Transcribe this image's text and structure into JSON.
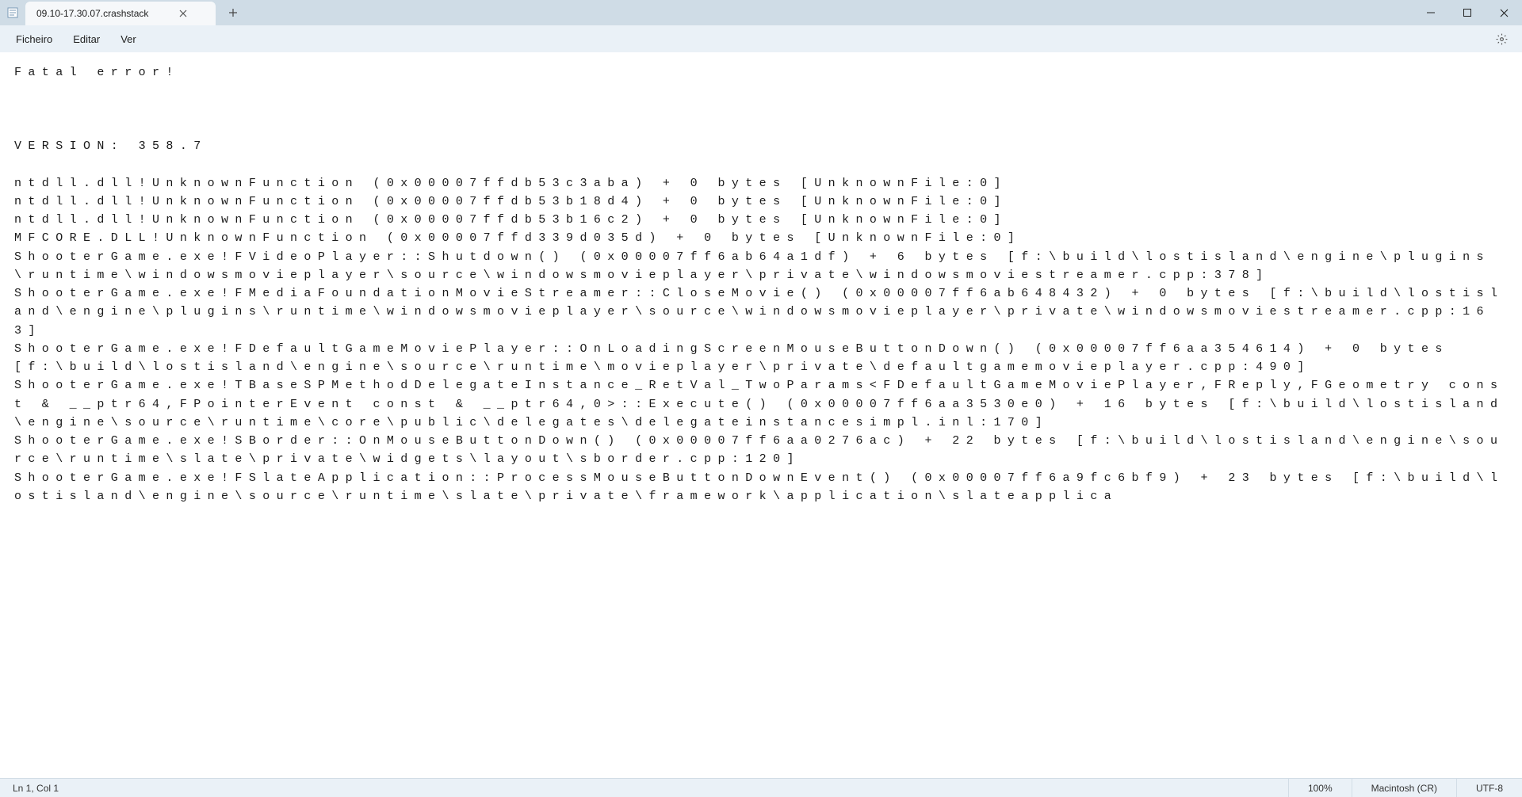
{
  "titlebar": {
    "tab_title": "09.10-17.30.07.crashstack"
  },
  "menubar": {
    "file": "Ficheiro",
    "edit": "Editar",
    "view": "Ver"
  },
  "editor": {
    "lines": [
      "Fatal error!",
      "",
      "",
      "",
      "VERSION: 358.7",
      "",
      "ntdll.dll!UnknownFunction (0x00007ffdb53c3aba) + 0 bytes [UnknownFile:0]",
      "ntdll.dll!UnknownFunction (0x00007ffdb53b18d4) + 0 bytes [UnknownFile:0]",
      "ntdll.dll!UnknownFunction (0x00007ffdb53b16c2) + 0 bytes [UnknownFile:0]",
      "MFCORE.DLL!UnknownFunction (0x00007ffd339d035d) + 0 bytes [UnknownFile:0]",
      "ShooterGame.exe!FVideoPlayer::Shutdown() (0x00007ff6ab64a1df) + 6 bytes [f:\\build\\lostisland\\engine\\plugins\\runtime\\windowsmovieplayer\\source\\windowsmovieplayer\\private\\windowsmoviestreamer.cpp:378]",
      "ShooterGame.exe!FMediaFoundationMovieStreamer::CloseMovie() (0x00007ff6ab648432) + 0 bytes [f:\\build\\lostisland\\engine\\plugins\\runtime\\windowsmovieplayer\\source\\windowsmovieplayer\\private\\windowsmoviestreamer.cpp:163]",
      "ShooterGame.exe!FDefaultGameMoviePlayer::OnLoadingScreenMouseButtonDown() (0x00007ff6aa354614) + 0 bytes [f:\\build\\lostisland\\engine\\source\\runtime\\movieplayer\\private\\defaultgamemovieplayer.cpp:490]",
      "ShooterGame.exe!TBaseSPMethodDelegateInstance_RetVal_TwoParams<FDefaultGameMoviePlayer,FReply,FGeometry const & __ptr64,FPointerEvent const & __ptr64,0>::Execute() (0x00007ff6aa3530e0) + 16 bytes [f:\\build\\lostisland\\engine\\source\\runtime\\core\\public\\delegates\\delegateinstancesimpl.inl:170]",
      "ShooterGame.exe!SBorder::OnMouseButtonDown() (0x00007ff6aa0276ac) + 22 bytes [f:\\build\\lostisland\\engine\\source\\runtime\\slate\\private\\widgets\\layout\\sborder.cpp:120]",
      "ShooterGame.exe!FSlateApplication::ProcessMouseButtonDownEvent() (0x00007ff6a9fc6bf9) + 23 bytes [f:\\build\\lostisland\\engine\\source\\runtime\\slate\\private\\framework\\application\\slateapplica"
    ]
  },
  "statusbar": {
    "position": "Ln 1, Col 1",
    "zoom": "100%",
    "line_ending": "Macintosh (CR)",
    "encoding": "UTF-8"
  }
}
